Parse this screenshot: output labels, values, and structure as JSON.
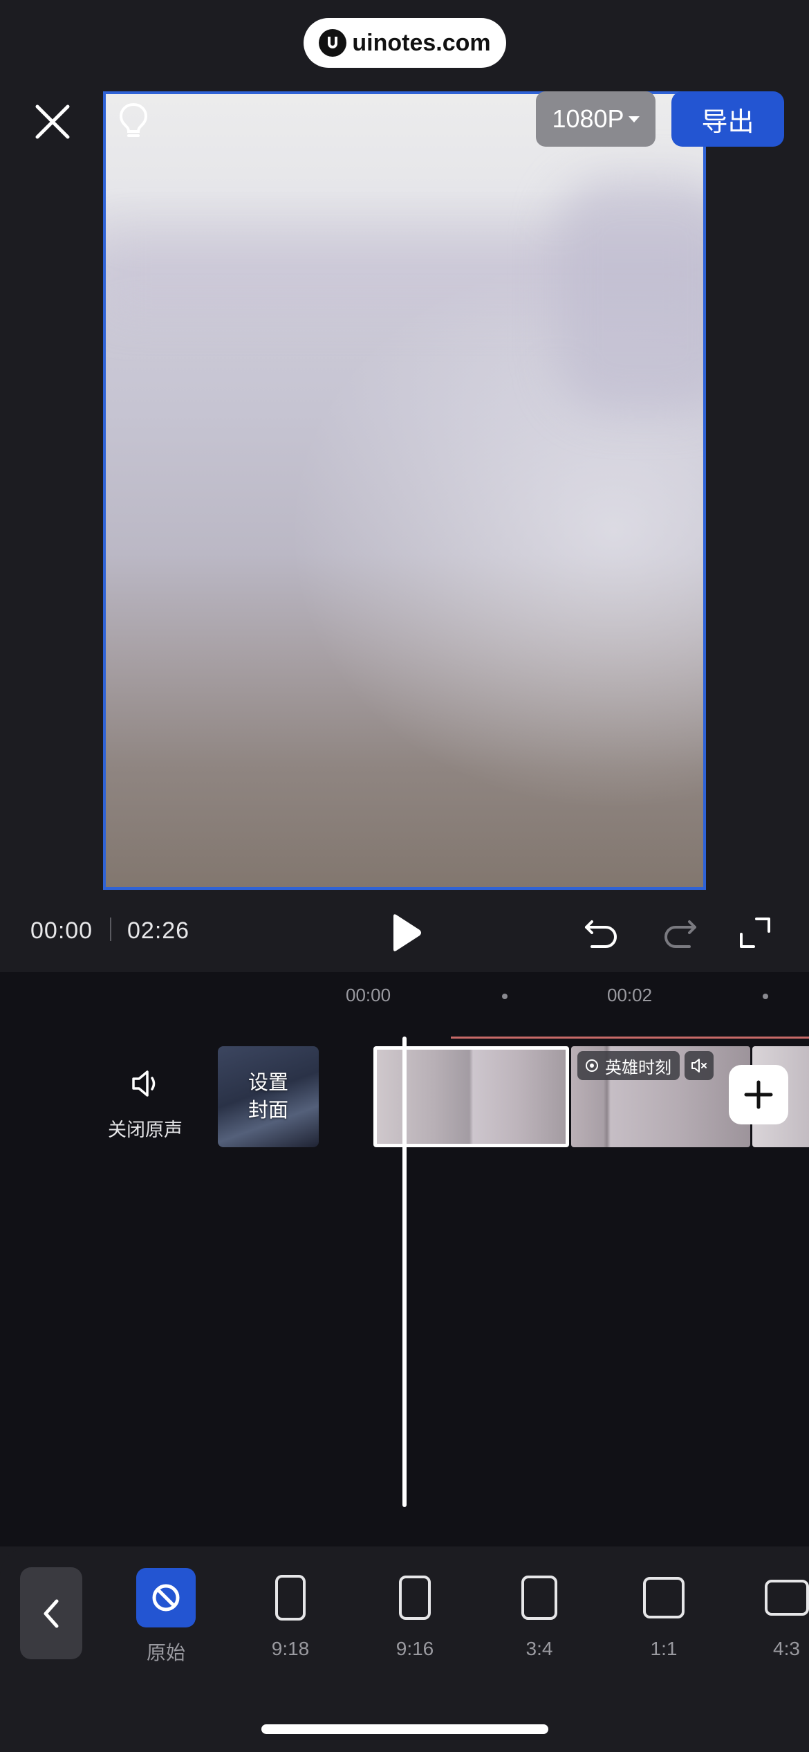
{
  "watermark": {
    "text": "uinotes.com"
  },
  "header": {
    "resolution_label": "1080P",
    "export_label": "导出"
  },
  "playback": {
    "current_time": "00:00",
    "total_time": "02:26"
  },
  "timeline": {
    "ruler_labels": [
      "00:00",
      "00:02"
    ],
    "mute_label": "关闭原声",
    "cover_label_line1": "设置",
    "cover_label_line2": "封面",
    "hero_tag_label": "英雄时刻"
  },
  "aspect_ratios": {
    "selected_index": 0,
    "items": [
      {
        "label": "原始",
        "icon": "ban-icon"
      },
      {
        "label": "9:18",
        "icon": "ratio-9-18-icon"
      },
      {
        "label": "9:16",
        "icon": "ratio-9-16-icon"
      },
      {
        "label": "3:4",
        "icon": "ratio-3-4-icon"
      },
      {
        "label": "1:1",
        "icon": "ratio-1-1-icon"
      },
      {
        "label": "4:3",
        "icon": "ratio-4-3-icon"
      }
    ]
  },
  "colors": {
    "accent": "#2355d2",
    "preview_border": "#2f63d6",
    "background": "#1c1c21",
    "timeline_bg": "#111116",
    "audio_line": "#c86a68"
  }
}
